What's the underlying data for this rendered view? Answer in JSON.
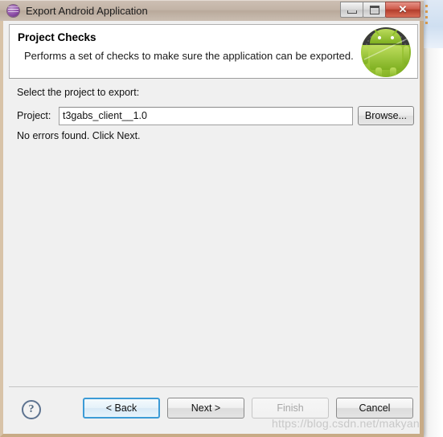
{
  "window": {
    "title": "Export Android Application",
    "app_icon": "eclipse-sphere-icon",
    "controls": {
      "minimize": "minimize-icon",
      "maximize": "maximize-icon",
      "close": "✕"
    }
  },
  "header": {
    "title": "Project Checks",
    "description": "Performs a set of checks to make sure the application can be exported.",
    "logo": "android-robot-icon"
  },
  "body": {
    "select_label": "Select the project to export:",
    "project_label": "Project:",
    "project_value": "t3gabs_client__1.0",
    "project_placeholder": "",
    "browse_label": "Browse...",
    "status_text": "No errors found. Click Next."
  },
  "footer": {
    "help_label": "?",
    "buttons": [
      {
        "label": "< Back",
        "state": "focused"
      },
      {
        "label": "Next >",
        "state": "enabled"
      },
      {
        "label": "Finish",
        "state": "disabled"
      },
      {
        "label": "Cancel",
        "state": "enabled"
      }
    ]
  },
  "watermark": "https://blog.csdn.net/makyan",
  "colors": {
    "titlebar": "#c2b3a6",
    "dialog_border": "#c8ab86",
    "body_bg": "#f0f0f0",
    "header_bg": "#ffffff",
    "close_button": "#cf5c4c",
    "focus_blue": "#3c9bd6",
    "android_green": "#a4cc3c",
    "eclipse_purple": "#8e4ea8"
  }
}
